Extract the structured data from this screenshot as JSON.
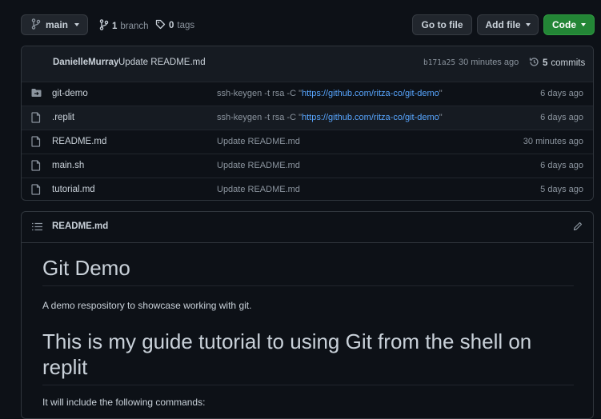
{
  "branch_selector": {
    "label": "main"
  },
  "branches": {
    "count": "1",
    "label": "branch"
  },
  "tags": {
    "count": "0",
    "label": "tags"
  },
  "toolbar": {
    "go_to_file": "Go to file",
    "add_file": "Add file",
    "code": "Code"
  },
  "latest_commit": {
    "author": "DanielleMurray",
    "message": "Update README.md",
    "sha": "b171a25",
    "time": "30 minutes ago",
    "commit_count": "5",
    "commit_label": "commits"
  },
  "files": [
    {
      "icon": "folder-submodule-icon",
      "name": "git-demo",
      "msg_prefix": "ssh-keygen -t rsa -C \"",
      "msg_link": "https://github.com/ritza-co/git-demo",
      "msg_suffix": "\"",
      "age": "6 days ago"
    },
    {
      "icon": "file-icon",
      "name": ".replit",
      "msg_prefix": "ssh-keygen -t rsa -C \"",
      "msg_link": "https://github.com/ritza-co/git-demo",
      "msg_suffix": "\"",
      "age": "6 days ago"
    },
    {
      "icon": "file-icon",
      "name": "README.md",
      "msg_prefix": "Update README.md",
      "msg_link": "",
      "msg_suffix": "",
      "age": "30 minutes ago"
    },
    {
      "icon": "file-icon",
      "name": "main.sh",
      "msg_prefix": "Update README.md",
      "msg_link": "",
      "msg_suffix": "",
      "age": "6 days ago"
    },
    {
      "icon": "file-icon",
      "name": "tutorial.md",
      "msg_prefix": "Update README.md",
      "msg_link": "",
      "msg_suffix": "",
      "age": "5 days ago"
    }
  ],
  "readme": {
    "filename": "README.md",
    "title": "Git Demo",
    "description": "A demo respository to showcase working with git.",
    "heading2_line1": "This is my guide tutorial to using Git from the shell on",
    "heading2_line2": "replit",
    "cut_text": "It will include the following commands:"
  },
  "colors": {
    "background": "#0d1117",
    "link": "#58a6ff",
    "code_button": "#238636",
    "muted": "#8b949e"
  }
}
